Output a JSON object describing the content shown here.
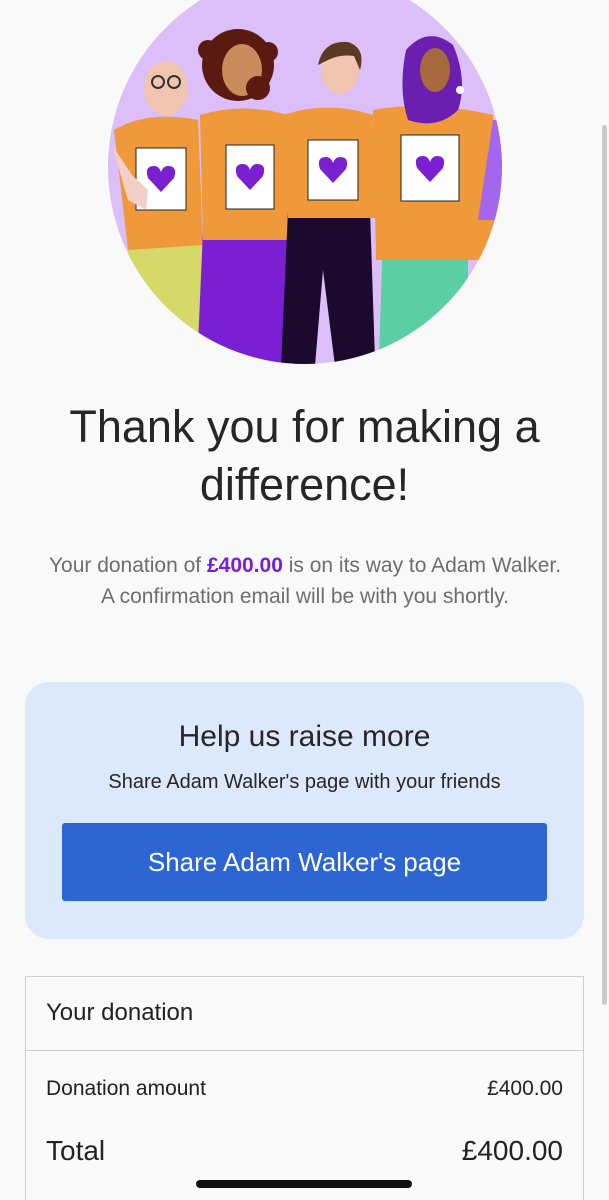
{
  "confirmation": {
    "title": "Thank you for making a difference!",
    "message_prefix": "Your donation of ",
    "amount": "£400.00",
    "message_suffix": " is on its way to Adam Walker.",
    "email_notice": "A confirmation email will be with you shortly."
  },
  "share": {
    "heading": "Help us raise more",
    "subheading": "Share Adam Walker's page with your friends",
    "button_label": "Share Adam Walker's page"
  },
  "summary": {
    "title": "Your donation",
    "rows": [
      {
        "label": "Donation amount",
        "value": "£400.00"
      },
      {
        "label": "Total",
        "value": "£400.00"
      }
    ]
  },
  "colors": {
    "accent_purple": "#7a1fd1",
    "share_card_bg": "#dce8fb",
    "button_blue": "#2d66d3",
    "illustration_circle": "#dcbef8",
    "shirt_orange": "#f0993a"
  }
}
